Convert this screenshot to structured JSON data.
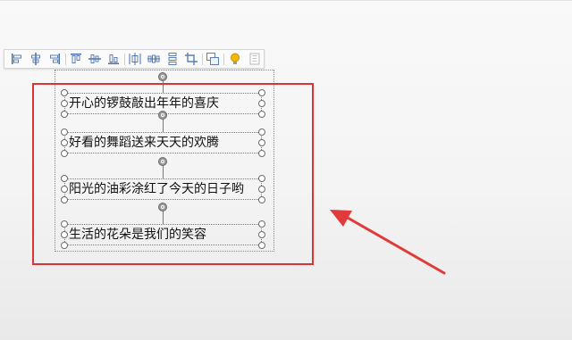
{
  "toolbar": {
    "buttons": [
      {
        "icon": "align-left-icon"
      },
      {
        "icon": "align-center-icon"
      },
      {
        "icon": "align-right-icon"
      },
      {
        "icon": "align-top-icon"
      },
      {
        "icon": "align-middle-icon"
      },
      {
        "icon": "align-bottom-icon"
      },
      {
        "icon": "distribute-horizontal-icon"
      },
      {
        "icon": "distribute-vertical-icon"
      },
      {
        "icon": "equal-spacing-icon"
      },
      {
        "icon": "crop-icon"
      },
      {
        "icon": "group-icon"
      },
      {
        "icon": "idea-bulb-icon"
      },
      {
        "icon": "settings-icon"
      }
    ]
  },
  "text_boxes": [
    {
      "text": "开心的锣鼓敲出年年的喜庆"
    },
    {
      "text": "好看的舞蹈送来天天的欢腾"
    },
    {
      "text": "阳光的油彩涂红了今天的日子哟"
    },
    {
      "text": "生活的花朵是我们的笑容"
    }
  ],
  "colors": {
    "highlight": "#dd3333",
    "arrow": "#e03a3a",
    "bulb": "#f2b705"
  }
}
